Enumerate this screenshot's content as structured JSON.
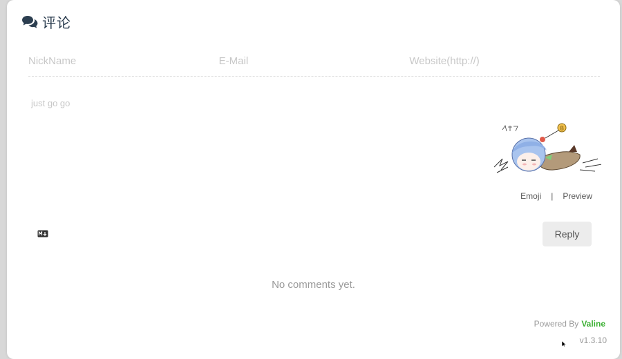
{
  "header": {
    "icon": "comments-icon",
    "title": "评论"
  },
  "form": {
    "nick_placeholder": "NickName",
    "email_placeholder": "E-Mail",
    "website_placeholder": "Website(http://)",
    "comment_placeholder": "just go go"
  },
  "tools": {
    "emoji_label": "Emoji",
    "separator": "|",
    "preview_label": "Preview"
  },
  "markdown_icon": "markdown-icon",
  "reply_label": "Reply",
  "empty_message": "No comments yet.",
  "footer": {
    "powered_label": "Powered By",
    "brand": "Valine",
    "version": "v1.3.10"
  },
  "colors": {
    "title": "#2c3e50",
    "brand": "#3cb034",
    "placeholder": "#c7c7c7",
    "button_bg": "#ececec"
  }
}
